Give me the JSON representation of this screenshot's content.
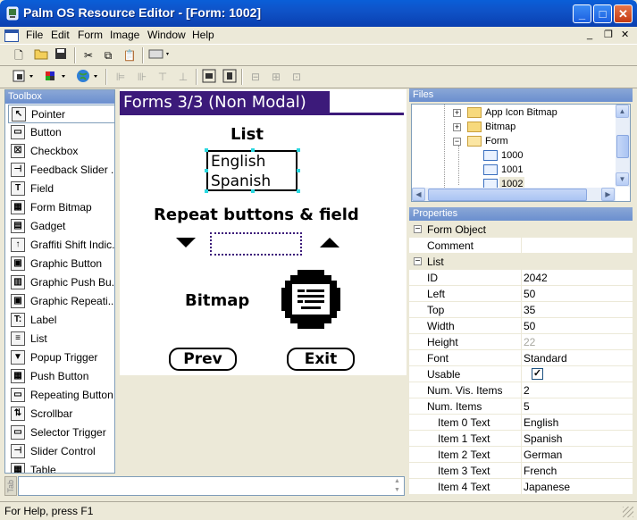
{
  "window": {
    "title": "Palm OS Resource Editor - [Form: 1002]",
    "minimize_glyph": "_",
    "maximize_glyph": "□",
    "close_glyph": "✕"
  },
  "menubar": {
    "items": [
      "File",
      "Edit",
      "Form",
      "Image",
      "Window",
      "Help"
    ],
    "mdi_controls": [
      "_",
      "❐",
      "✕"
    ]
  },
  "toolbox": {
    "header": "Toolbox",
    "items": [
      {
        "label": "Pointer",
        "icon": "pointer-icon",
        "glyph": "↖"
      },
      {
        "label": "Button",
        "icon": "button-icon",
        "glyph": "▭"
      },
      {
        "label": "Checkbox",
        "icon": "checkbox-icon",
        "glyph": "☒"
      },
      {
        "label": "Feedback Slider ...",
        "icon": "feedback-slider-icon",
        "glyph": "⊣"
      },
      {
        "label": "Field",
        "icon": "field-icon",
        "glyph": "T"
      },
      {
        "label": "Form Bitmap",
        "icon": "form-bitmap-icon",
        "glyph": "▦"
      },
      {
        "label": "Gadget",
        "icon": "gadget-icon",
        "glyph": "▤"
      },
      {
        "label": "Graffiti Shift Indic...",
        "icon": "graffiti-shift-icon",
        "glyph": "↑"
      },
      {
        "label": "Graphic Button",
        "icon": "graphic-button-icon",
        "glyph": "▣"
      },
      {
        "label": "Graphic Push Bu...",
        "icon": "graphic-push-button-icon",
        "glyph": "▥"
      },
      {
        "label": "Graphic Repeati...",
        "icon": "graphic-repeat-icon",
        "glyph": "▣"
      },
      {
        "label": "Label",
        "icon": "label-icon",
        "glyph": "T:"
      },
      {
        "label": "List",
        "icon": "list-icon",
        "glyph": "≡"
      },
      {
        "label": "Popup Trigger",
        "icon": "popup-trigger-icon",
        "glyph": "▼"
      },
      {
        "label": "Push Button",
        "icon": "push-button-icon",
        "glyph": "▦"
      },
      {
        "label": "Repeating Button",
        "icon": "repeating-button-icon",
        "glyph": "▭"
      },
      {
        "label": "Scrollbar",
        "icon": "scrollbar-icon",
        "glyph": "⇅"
      },
      {
        "label": "Selector Trigger",
        "icon": "selector-trigger-icon",
        "glyph": "▭"
      },
      {
        "label": "Slider Control",
        "icon": "slider-control-icon",
        "glyph": "⊣"
      },
      {
        "label": "Table",
        "icon": "table-icon",
        "glyph": "▦"
      }
    ]
  },
  "form": {
    "title": "Forms 3/3 (Non Modal)",
    "list_label": "List",
    "list_items": [
      "English",
      "Spanish"
    ],
    "repeat_label": "Repeat buttons & field",
    "bitmap_label": "Bitmap",
    "prev_button": "Prev",
    "exit_button": "Exit"
  },
  "files": {
    "header": "Files",
    "nodes": [
      {
        "label": "App Icon Bitmap",
        "type": "folder",
        "expander": "+"
      },
      {
        "label": "Bitmap",
        "type": "folder",
        "expander": "+"
      },
      {
        "label": "Form",
        "type": "folder",
        "expander": "−"
      },
      {
        "label": "1000",
        "type": "form"
      },
      {
        "label": "1001",
        "type": "form"
      },
      {
        "label": "1002",
        "type": "form",
        "selected": true
      }
    ]
  },
  "properties": {
    "header": "Properties",
    "rows": [
      {
        "name": "Form Object",
        "value": "",
        "category": true,
        "expander": "−"
      },
      {
        "name": "Comment",
        "value": ""
      },
      {
        "name": "List",
        "value": "",
        "category": true,
        "expander": "−"
      },
      {
        "name": "ID",
        "value": "2042"
      },
      {
        "name": "Left",
        "value": "50"
      },
      {
        "name": "Top",
        "value": "35"
      },
      {
        "name": "Width",
        "value": "50"
      },
      {
        "name": "Height",
        "value": "22",
        "dim": true
      },
      {
        "name": "Font",
        "value": "Standard"
      },
      {
        "name": "Usable",
        "value": "",
        "checked": true
      },
      {
        "name": "Num. Vis. Items",
        "value": "2"
      },
      {
        "name": "Num. Items",
        "value": "5"
      },
      {
        "name": "Item 0 Text",
        "value": "English",
        "indent": true
      },
      {
        "name": "Item 1 Text",
        "value": "Spanish",
        "indent": true
      },
      {
        "name": "Item 2 Text",
        "value": "German",
        "indent": true
      },
      {
        "name": "Item 3 Text",
        "value": "French",
        "indent": true
      },
      {
        "name": "Item 4 Text",
        "value": "Japanese",
        "indent": true
      }
    ]
  },
  "bottom": {
    "tab_label": "Tab"
  },
  "status": {
    "text": "For Help, press F1"
  }
}
